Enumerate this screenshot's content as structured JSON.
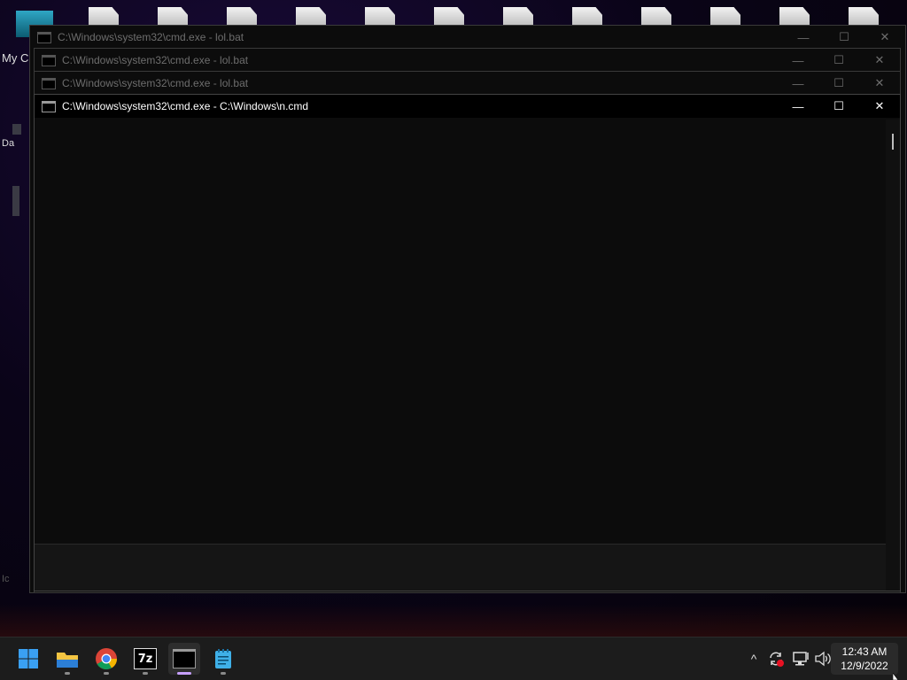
{
  "desktop": {
    "left_labels": [
      "My C",
      "Da",
      "Ic"
    ]
  },
  "windows": [
    {
      "title": "C:\\Windows\\system32\\cmd.exe - lol.bat",
      "active": false
    },
    {
      "title": "C:\\Windows\\system32\\cmd.exe - lol.bat",
      "active": false
    },
    {
      "title": "C:\\Windows\\system32\\cmd.exe - lol.bat",
      "active": false
    },
    {
      "title": "C:\\Windows\\system32\\cmd.exe - C:\\Windows\\n.cmd",
      "active": true
    }
  ],
  "window_controls": {
    "minimize": "—",
    "maximize": "☐",
    "close": "✕"
  },
  "taskbar": {
    "apps": [
      {
        "name": "start",
        "icon": "windows-start-icon"
      },
      {
        "name": "file-explorer",
        "icon": "folder-icon"
      },
      {
        "name": "chrome",
        "icon": "chrome-icon"
      },
      {
        "name": "7-zip",
        "icon": "7zip-icon",
        "label": "7z"
      },
      {
        "name": "command-prompt",
        "icon": "terminal-icon"
      },
      {
        "name": "notepad",
        "icon": "notepad-icon"
      }
    ],
    "tray": {
      "chevron": "^",
      "clock_time": "12:43 AM",
      "clock_date": "12/9/2022"
    }
  },
  "colors": {
    "start_blue": "#3aa0f3",
    "active_indicator": "#c7a0ff",
    "folder_yellow": "#f4c542"
  }
}
